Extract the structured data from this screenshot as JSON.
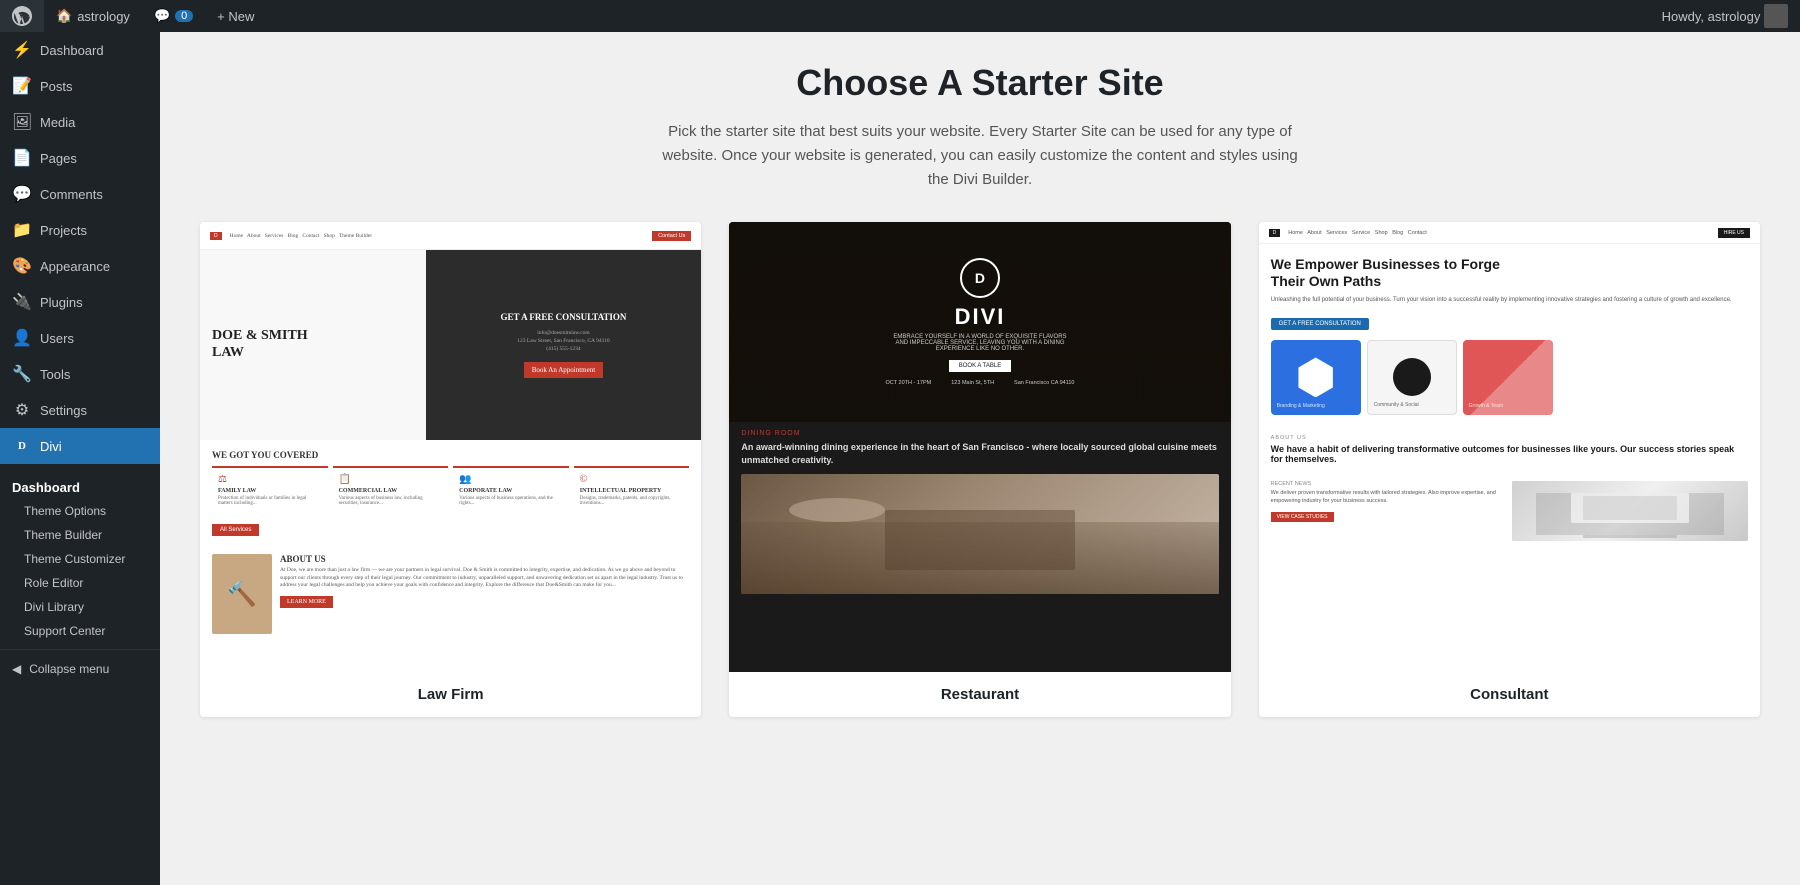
{
  "adminbar": {
    "site_name": "astrology",
    "comments_count": "0",
    "new_label": "+ New",
    "howdy_label": "Howdy, astrology",
    "wp_icon": "W"
  },
  "sidebar": {
    "items": [
      {
        "id": "dashboard",
        "label": "Dashboard",
        "icon": "⚡"
      },
      {
        "id": "posts",
        "label": "Posts",
        "icon": "📝"
      },
      {
        "id": "media",
        "label": "Media",
        "icon": "🖼"
      },
      {
        "id": "pages",
        "label": "Pages",
        "icon": "📄"
      },
      {
        "id": "comments",
        "label": "Comments",
        "icon": "💬"
      },
      {
        "id": "projects",
        "label": "Projects",
        "icon": "📁"
      },
      {
        "id": "appearance",
        "label": "Appearance",
        "icon": "🎨"
      },
      {
        "id": "plugins",
        "label": "Plugins",
        "icon": "🔌"
      },
      {
        "id": "users",
        "label": "Users",
        "icon": "👤"
      },
      {
        "id": "tools",
        "label": "Tools",
        "icon": "🔧"
      },
      {
        "id": "settings",
        "label": "Settings",
        "icon": "⚙"
      },
      {
        "id": "divi",
        "label": "Divi",
        "icon": "D",
        "active": true
      }
    ],
    "divi_submenu": {
      "title": "Dashboard",
      "items": [
        {
          "id": "theme-options",
          "label": "Theme Options"
        },
        {
          "id": "theme-builder",
          "label": "Theme Builder"
        },
        {
          "id": "theme-customizer",
          "label": "Theme Customizer"
        },
        {
          "id": "role-editor",
          "label": "Role Editor"
        },
        {
          "id": "divi-library",
          "label": "Divi Library"
        },
        {
          "id": "support-center",
          "label": "Support Center"
        }
      ]
    },
    "collapse_label": "Collapse menu"
  },
  "main": {
    "page_title": "Choose A Starter Site",
    "page_description": "Pick the starter site that best suits your website. Every Starter Site can be used for any type of website. Once your website is generated, you can easily customize the content and styles using the Divi Builder.",
    "sites": [
      {
        "id": "law-firm",
        "label": "Law Firm"
      },
      {
        "id": "restaurant",
        "label": "Restaurant"
      },
      {
        "id": "consultant",
        "label": "Consultant"
      }
    ]
  }
}
